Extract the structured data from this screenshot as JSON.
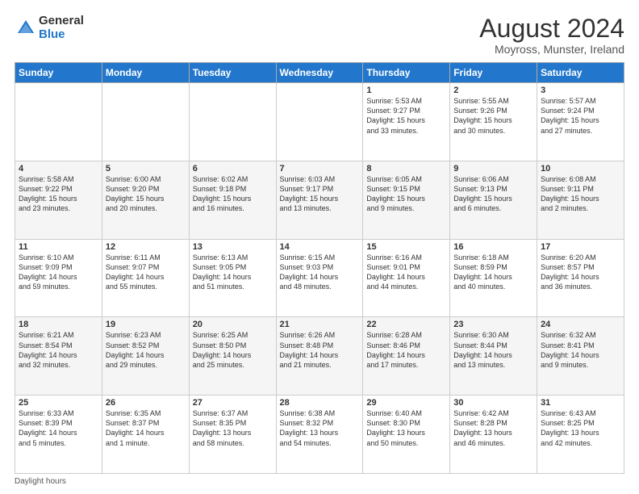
{
  "logo": {
    "general": "General",
    "blue": "Blue"
  },
  "title": "August 2024",
  "subtitle": "Moyross, Munster, Ireland",
  "days": [
    "Sunday",
    "Monday",
    "Tuesday",
    "Wednesday",
    "Thursday",
    "Friday",
    "Saturday"
  ],
  "weeks": [
    [
      {
        "num": "",
        "info": ""
      },
      {
        "num": "",
        "info": ""
      },
      {
        "num": "",
        "info": ""
      },
      {
        "num": "",
        "info": ""
      },
      {
        "num": "1",
        "info": "Sunrise: 5:53 AM\nSunset: 9:27 PM\nDaylight: 15 hours\nand 33 minutes."
      },
      {
        "num": "2",
        "info": "Sunrise: 5:55 AM\nSunset: 9:26 PM\nDaylight: 15 hours\nand 30 minutes."
      },
      {
        "num": "3",
        "info": "Sunrise: 5:57 AM\nSunset: 9:24 PM\nDaylight: 15 hours\nand 27 minutes."
      }
    ],
    [
      {
        "num": "4",
        "info": "Sunrise: 5:58 AM\nSunset: 9:22 PM\nDaylight: 15 hours\nand 23 minutes."
      },
      {
        "num": "5",
        "info": "Sunrise: 6:00 AM\nSunset: 9:20 PM\nDaylight: 15 hours\nand 20 minutes."
      },
      {
        "num": "6",
        "info": "Sunrise: 6:02 AM\nSunset: 9:18 PM\nDaylight: 15 hours\nand 16 minutes."
      },
      {
        "num": "7",
        "info": "Sunrise: 6:03 AM\nSunset: 9:17 PM\nDaylight: 15 hours\nand 13 minutes."
      },
      {
        "num": "8",
        "info": "Sunrise: 6:05 AM\nSunset: 9:15 PM\nDaylight: 15 hours\nand 9 minutes."
      },
      {
        "num": "9",
        "info": "Sunrise: 6:06 AM\nSunset: 9:13 PM\nDaylight: 15 hours\nand 6 minutes."
      },
      {
        "num": "10",
        "info": "Sunrise: 6:08 AM\nSunset: 9:11 PM\nDaylight: 15 hours\nand 2 minutes."
      }
    ],
    [
      {
        "num": "11",
        "info": "Sunrise: 6:10 AM\nSunset: 9:09 PM\nDaylight: 14 hours\nand 59 minutes."
      },
      {
        "num": "12",
        "info": "Sunrise: 6:11 AM\nSunset: 9:07 PM\nDaylight: 14 hours\nand 55 minutes."
      },
      {
        "num": "13",
        "info": "Sunrise: 6:13 AM\nSunset: 9:05 PM\nDaylight: 14 hours\nand 51 minutes."
      },
      {
        "num": "14",
        "info": "Sunrise: 6:15 AM\nSunset: 9:03 PM\nDaylight: 14 hours\nand 48 minutes."
      },
      {
        "num": "15",
        "info": "Sunrise: 6:16 AM\nSunset: 9:01 PM\nDaylight: 14 hours\nand 44 minutes."
      },
      {
        "num": "16",
        "info": "Sunrise: 6:18 AM\nSunset: 8:59 PM\nDaylight: 14 hours\nand 40 minutes."
      },
      {
        "num": "17",
        "info": "Sunrise: 6:20 AM\nSunset: 8:57 PM\nDaylight: 14 hours\nand 36 minutes."
      }
    ],
    [
      {
        "num": "18",
        "info": "Sunrise: 6:21 AM\nSunset: 8:54 PM\nDaylight: 14 hours\nand 32 minutes."
      },
      {
        "num": "19",
        "info": "Sunrise: 6:23 AM\nSunset: 8:52 PM\nDaylight: 14 hours\nand 29 minutes."
      },
      {
        "num": "20",
        "info": "Sunrise: 6:25 AM\nSunset: 8:50 PM\nDaylight: 14 hours\nand 25 minutes."
      },
      {
        "num": "21",
        "info": "Sunrise: 6:26 AM\nSunset: 8:48 PM\nDaylight: 14 hours\nand 21 minutes."
      },
      {
        "num": "22",
        "info": "Sunrise: 6:28 AM\nSunset: 8:46 PM\nDaylight: 14 hours\nand 17 minutes."
      },
      {
        "num": "23",
        "info": "Sunrise: 6:30 AM\nSunset: 8:44 PM\nDaylight: 14 hours\nand 13 minutes."
      },
      {
        "num": "24",
        "info": "Sunrise: 6:32 AM\nSunset: 8:41 PM\nDaylight: 14 hours\nand 9 minutes."
      }
    ],
    [
      {
        "num": "25",
        "info": "Sunrise: 6:33 AM\nSunset: 8:39 PM\nDaylight: 14 hours\nand 5 minutes."
      },
      {
        "num": "26",
        "info": "Sunrise: 6:35 AM\nSunset: 8:37 PM\nDaylight: 14 hours\nand 1 minute."
      },
      {
        "num": "27",
        "info": "Sunrise: 6:37 AM\nSunset: 8:35 PM\nDaylight: 13 hours\nand 58 minutes."
      },
      {
        "num": "28",
        "info": "Sunrise: 6:38 AM\nSunset: 8:32 PM\nDaylight: 13 hours\nand 54 minutes."
      },
      {
        "num": "29",
        "info": "Sunrise: 6:40 AM\nSunset: 8:30 PM\nDaylight: 13 hours\nand 50 minutes."
      },
      {
        "num": "30",
        "info": "Sunrise: 6:42 AM\nSunset: 8:28 PM\nDaylight: 13 hours\nand 46 minutes."
      },
      {
        "num": "31",
        "info": "Sunrise: 6:43 AM\nSunset: 8:25 PM\nDaylight: 13 hours\nand 42 minutes."
      }
    ]
  ],
  "footer": "Daylight hours"
}
